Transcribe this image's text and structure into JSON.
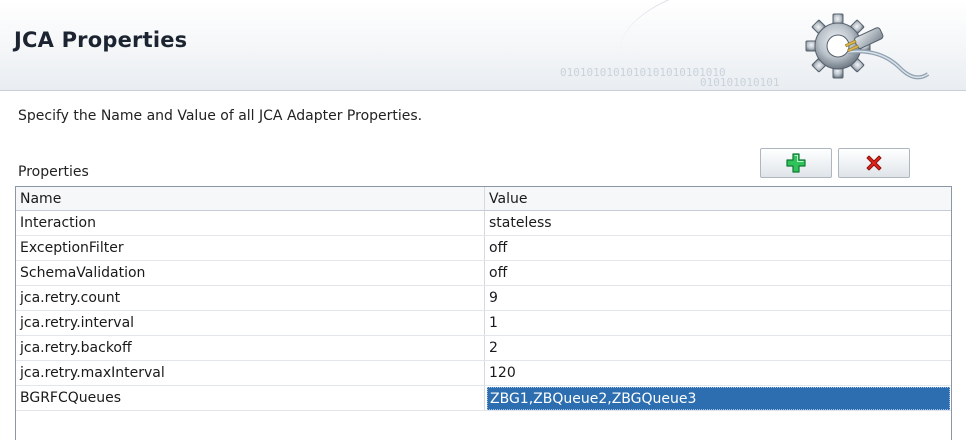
{
  "header": {
    "title": "JCA Properties",
    "binary_line_1": "0101010101010101010101010",
    "binary_line_2": "010101010101"
  },
  "description": "Specify the Name and Value of all JCA Adapter Properties.",
  "properties": {
    "label": "Properties",
    "columns": {
      "name": "Name",
      "value": "Value"
    },
    "rows": [
      {
        "name": "Interaction",
        "value": "stateless"
      },
      {
        "name": "ExceptionFilter",
        "value": "off"
      },
      {
        "name": "SchemaValidation",
        "value": "off"
      },
      {
        "name": "jca.retry.count",
        "value": "9"
      },
      {
        "name": "jca.retry.interval",
        "value": "1"
      },
      {
        "name": "jca.retry.backoff",
        "value": "2"
      },
      {
        "name": "jca.retry.maxInterval",
        "value": "120"
      },
      {
        "name": "BGRFCQueues",
        "value": "ZBG1,ZBQueue2,ZBGQueue3"
      }
    ],
    "selected_row": 7
  },
  "toolbar": {
    "add_icon": "plus-icon",
    "remove_icon": "x-icon"
  },
  "colors": {
    "add": "#1bb34a",
    "remove": "#d7261e",
    "selection": "#2c6eaf"
  }
}
